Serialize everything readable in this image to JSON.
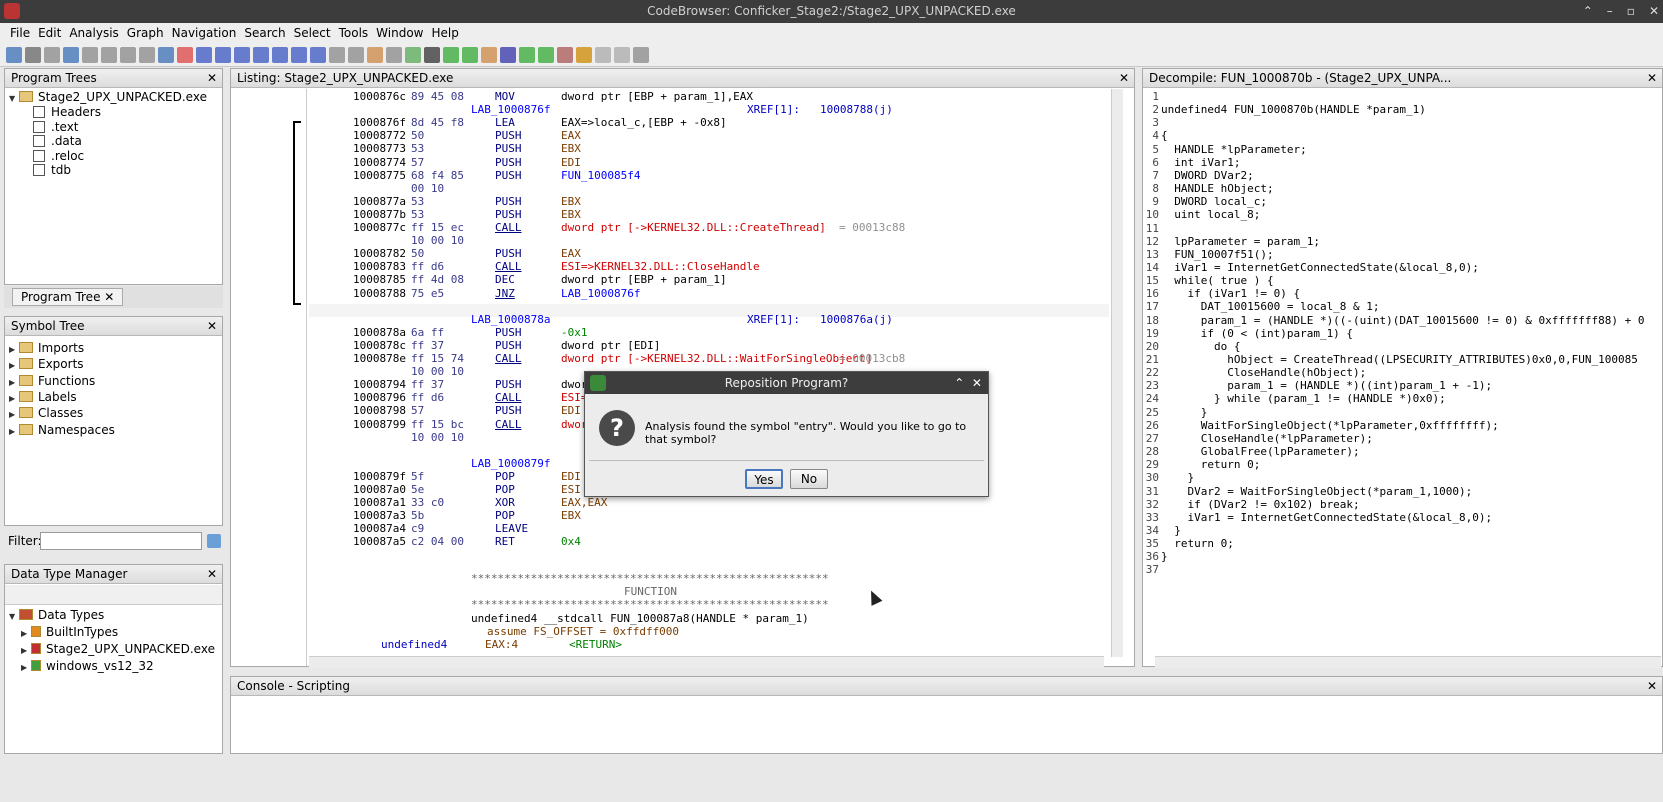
{
  "window_title": "CodeBrowser: Conficker_Stage2:/Stage2_UPX_UNPACKED.exe",
  "menu": [
    "File",
    "Edit",
    "Analysis",
    "Graph",
    "Navigation",
    "Search",
    "Select",
    "Tools",
    "Window",
    "Help"
  ],
  "program_trees": {
    "title": "Program Trees",
    "root": "Stage2_UPX_UNPACKED.exe",
    "children": [
      "Headers",
      ".text",
      ".data",
      ".reloc",
      "tdb"
    ],
    "tab": "Program Tree"
  },
  "symbol_tree": {
    "title": "Symbol Tree",
    "items": [
      "Imports",
      "Exports",
      "Functions",
      "Labels",
      "Classes",
      "Namespaces"
    ]
  },
  "filter": {
    "label": "Filter:",
    "value": ""
  },
  "data_type_manager": {
    "title": "Data Type Manager",
    "root": "Data Types",
    "items": [
      "BuiltInTypes",
      "Stage2_UPX_UNPACKED.exe",
      "windows_vs12_32"
    ]
  },
  "listing": {
    "title": "Listing:  Stage2_UPX_UNPACKED.exe",
    "rows": [
      {
        "a": "1000876c",
        "b": "89 45 08",
        "m": "MOV",
        "o": "dword ptr [EBP + param_1],EAX"
      },
      {
        "lbl": "LAB_1000876f",
        "xref": "XREF[1]:",
        "xto": "10008788(j)"
      },
      {
        "a": "1000876f",
        "b": "8d 45 f8",
        "m": "LEA",
        "o": "EAX=>local_c,[EBP + -0x8]"
      },
      {
        "a": "10008772",
        "b": "50",
        "m": "PUSH",
        "o": "EAX"
      },
      {
        "a": "10008773",
        "b": "53",
        "m": "PUSH",
        "o": "EBX"
      },
      {
        "a": "10008774",
        "b": "57",
        "m": "PUSH",
        "o": "EDI"
      },
      {
        "a": "10008775",
        "b": "68 f4 85",
        "m": "PUSH",
        "o": "FUN_100085f4"
      },
      {
        "a": "",
        "b": "00 10",
        "m": "",
        "o": ""
      },
      {
        "a": "1000877a",
        "b": "53",
        "m": "PUSH",
        "o": "EBX"
      },
      {
        "a": "1000877b",
        "b": "53",
        "m": "PUSH",
        "o": "EBX"
      },
      {
        "a": "1000877c",
        "b": "ff 15 ec",
        "m": "CALL",
        "o": "dword ptr [->KERNEL32.DLL::CreateThread]",
        "c": "= 00013c88"
      },
      {
        "a": "",
        "b": "10 00 10",
        "m": "",
        "o": ""
      },
      {
        "a": "10008782",
        "b": "50",
        "m": "PUSH",
        "o": "EAX"
      },
      {
        "a": "10008783",
        "b": "ff d6",
        "m": "CALL",
        "o": "ESI=>KERNEL32.DLL::CloseHandle"
      },
      {
        "a": "10008785",
        "b": "ff 4d 08",
        "m": "DEC",
        "o": "dword ptr [EBP + param_1]"
      },
      {
        "a": "10008788",
        "b": "75 e5",
        "m": "JNZ",
        "o": "LAB_1000876f"
      },
      {
        "a": "",
        "b": "",
        "m": "",
        "o": ""
      },
      {
        "lbl": "LAB_1000878a",
        "xref": "XREF[1]:",
        "xto": "1000876a(j)"
      },
      {
        "a": "1000878a",
        "b": "6a ff",
        "m": "PUSH",
        "o": "-0x1"
      },
      {
        "a": "1000878c",
        "b": "ff 37",
        "m": "PUSH",
        "o": "dword ptr [EDI]"
      },
      {
        "a": "1000878e",
        "b": "ff 15 74",
        "m": "CALL",
        "o": "dword ptr [->KERNEL32.DLL::WaitForSingleObject]",
        "c": "= 00013cb8"
      },
      {
        "a": "",
        "b": "10 00 10",
        "m": "",
        "o": ""
      },
      {
        "a": "10008794",
        "b": "ff 37",
        "m": "PUSH",
        "o": "dword ptr [EDI]"
      },
      {
        "a": "10008796",
        "b": "ff d6",
        "m": "CALL",
        "o": "ESI=>KERNEL32.DLL::CloseHandle"
      },
      {
        "a": "10008798",
        "b": "57",
        "m": "PUSH",
        "o": "EDI"
      },
      {
        "a": "10008799",
        "b": "ff 15 bc",
        "m": "CALL",
        "o": "dword ptr [->KERNEL32.DLL::GlobalFree]"
      },
      {
        "a": "",
        "b": "10 00 10",
        "m": "",
        "o": ""
      },
      {
        "a": "",
        "b": "",
        "m": "",
        "o": ""
      },
      {
        "lbl": "LAB_1000879f",
        "xref": "",
        "xto": ""
      },
      {
        "a": "1000879f",
        "b": "5f",
        "m": "POP",
        "o": "EDI"
      },
      {
        "a": "100087a0",
        "b": "5e",
        "m": "POP",
        "o": "ESI"
      },
      {
        "a": "100087a1",
        "b": "33 c0",
        "m": "XOR",
        "o": "EAX,EAX"
      },
      {
        "a": "100087a3",
        "b": "5b",
        "m": "POP",
        "o": "EBX"
      },
      {
        "a": "100087a4",
        "b": "c9",
        "m": "LEAVE",
        "o": ""
      },
      {
        "a": "100087a5",
        "b": "c2 04 00",
        "m": "RET",
        "o": "0x4"
      }
    ],
    "func_banner_stars": "******************************************************",
    "func_banner_text": "FUNCTION",
    "func_sig": "undefined4 __stdcall FUN_100087a8(HANDLE * param_1)",
    "assume": "assume FS_OFFSET = 0xffdff000",
    "ret_type": "undefined4",
    "ret_reg": "EAX:4",
    "ret_name": "<RETURN>"
  },
  "decompile": {
    "title": "Decompile: FUN_1000870b - (Stage2_UPX_UNPA...",
    "lines": [
      "",
      "undefined4 FUN_1000870b(HANDLE *param_1)",
      "",
      "{",
      "  HANDLE *lpParameter;",
      "  int iVar1;",
      "  DWORD DVar2;",
      "  HANDLE hObject;",
      "  DWORD local_c;",
      "  uint local_8;",
      "",
      "  lpParameter = param_1;",
      "  FUN_10007f51();",
      "  iVar1 = InternetGetConnectedState(&local_8,0);",
      "  while( true ) {",
      "    if (iVar1 != 0) {",
      "      DAT_10015600 = local_8 & 1;",
      "      param_1 = (HANDLE *)((-(uint)(DAT_10015600 != 0) & 0xfffffff88) + 0",
      "      if (0 < (int)param_1) {",
      "        do {",
      "          hObject = CreateThread((LPSECURITY_ATTRIBUTES)0x0,0,FUN_100085",
      "          CloseHandle(hObject);",
      "          param_1 = (HANDLE *)((int)param_1 + -1);",
      "        } while (param_1 != (HANDLE *)0x0);",
      "      }",
      "      WaitForSingleObject(*lpParameter,0xffffffff);",
      "      CloseHandle(*lpParameter);",
      "      GlobalFree(lpParameter);",
      "      return 0;",
      "    }",
      "    DVar2 = WaitForSingleObject(*param_1,1000);",
      "    if (DVar2 != 0x102) break;",
      "    iVar1 = InternetGetConnectedState(&local_8,0);",
      "  }",
      "  return 0;",
      "}",
      ""
    ]
  },
  "console": {
    "title": "Console - Scripting"
  },
  "dialog": {
    "title": "Reposition Program?",
    "message": "Analysis found the symbol \"entry\".  Would you like to go to that symbol?",
    "yes": "Yes",
    "no": "No"
  }
}
